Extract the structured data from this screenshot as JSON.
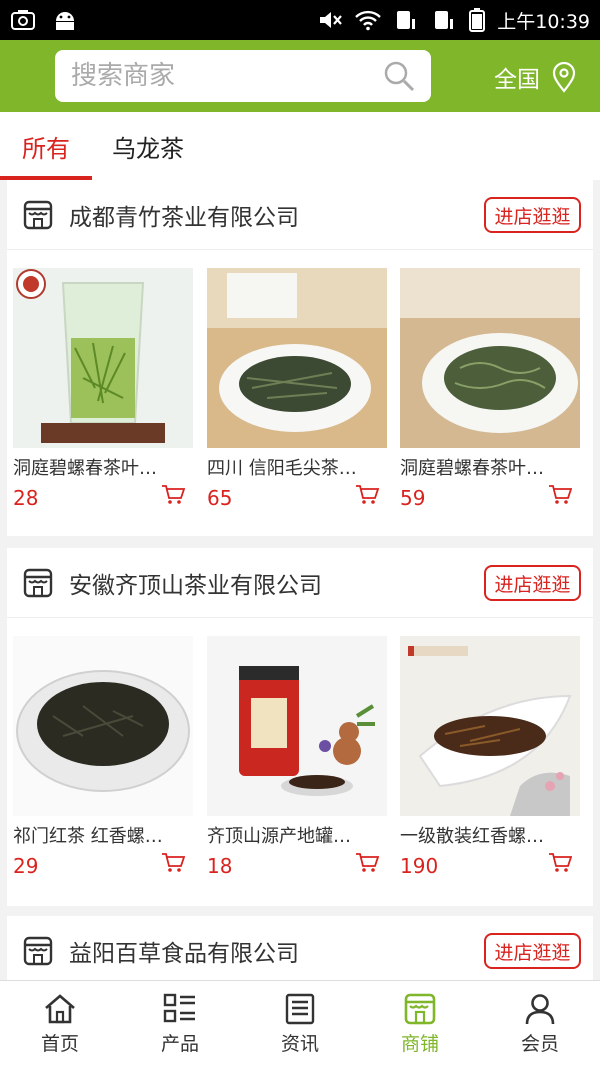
{
  "status_bar": {
    "time": "上午10:39"
  },
  "header": {
    "search_placeholder": "搜索商家",
    "region": "全国"
  },
  "tabs": [
    {
      "label": "所有"
    },
    {
      "label": "乌龙茶"
    }
  ],
  "shops": [
    {
      "name": "成都青竹茶业有限公司",
      "enter_label": "进店逛逛",
      "products": [
        {
          "name": "洞庭碧螺春茶叶…",
          "price": "28"
        },
        {
          "name": "四川 信阳毛尖茶…",
          "price": "65"
        },
        {
          "name": "洞庭碧螺春茶叶…",
          "price": "59"
        }
      ]
    },
    {
      "name": "安徽齐顶山茶业有限公司",
      "enter_label": "进店逛逛",
      "products": [
        {
          "name": "祁门红茶 红香螺…",
          "price": "29"
        },
        {
          "name": "齐顶山源产地罐…",
          "price": "18"
        },
        {
          "name": "一级散装红香螺…",
          "price": "190"
        }
      ]
    },
    {
      "name": "益阳百草食品有限公司",
      "enter_label": "进店逛逛",
      "products": []
    }
  ],
  "bottom_nav": [
    {
      "label": "首页",
      "icon": "home-icon"
    },
    {
      "label": "产品",
      "icon": "grid-list-icon"
    },
    {
      "label": "资讯",
      "icon": "news-icon"
    },
    {
      "label": "商铺",
      "icon": "shop-icon"
    },
    {
      "label": "会员",
      "icon": "user-icon"
    }
  ],
  "colors": {
    "brand_green": "#7fb62a",
    "accent_red": "#d9231f"
  }
}
